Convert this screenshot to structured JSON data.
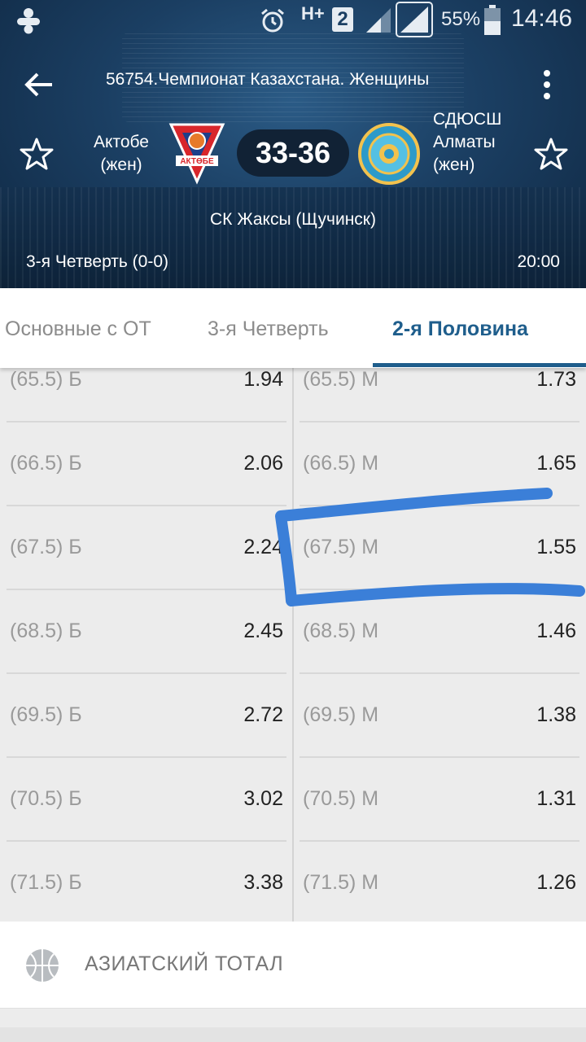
{
  "status_bar": {
    "network": "H+",
    "sim": "2",
    "battery": "55%",
    "time": "14:46"
  },
  "header": {
    "title": "56754.Чемпионат Казахстана. Женщины",
    "home_team": "Актобе (жен)",
    "home_logo_text": "АКТОБЕ",
    "away_team": "СДЮСШ Алматы (жен)",
    "score": "33-36",
    "venue": "СК Жаксы (Щучинск)",
    "period": "3-я  Четверть (0-0)",
    "time": "20:00"
  },
  "tabs": [
    {
      "label": "Основные с ОТ",
      "active": false
    },
    {
      "label": "3-я  Четверть",
      "active": false
    },
    {
      "label": "2-я  Половина",
      "active": true
    }
  ],
  "odds": [
    {
      "over_label": "(65.5) Б",
      "over": "1.94",
      "under_label": "(65.5) М",
      "under": "1.73"
    },
    {
      "over_label": "(66.5) Б",
      "over": "2.06",
      "under_label": "(66.5) М",
      "under": "1.65"
    },
    {
      "over_label": "(67.5) Б",
      "over": "2.24",
      "under_label": "(67.5) М",
      "under": "1.55"
    },
    {
      "over_label": "(68.5) Б",
      "over": "2.45",
      "under_label": "(68.5) М",
      "under": "1.46"
    },
    {
      "over_label": "(69.5) Б",
      "over": "2.72",
      "under_label": "(69.5) М",
      "under": "1.38"
    },
    {
      "over_label": "(70.5) Б",
      "over": "3.02",
      "under_label": "(70.5) М",
      "under": "1.31"
    },
    {
      "over_label": "(71.5) Б",
      "over": "3.38",
      "under_label": "(71.5) М",
      "under": "1.26"
    }
  ],
  "section": {
    "label": "АЗИАТСКИЙ ТОТАЛ",
    "icon": "basketball-icon"
  },
  "colors": {
    "accent": "#1f5e8c",
    "annotation": "#3b7fd8"
  }
}
